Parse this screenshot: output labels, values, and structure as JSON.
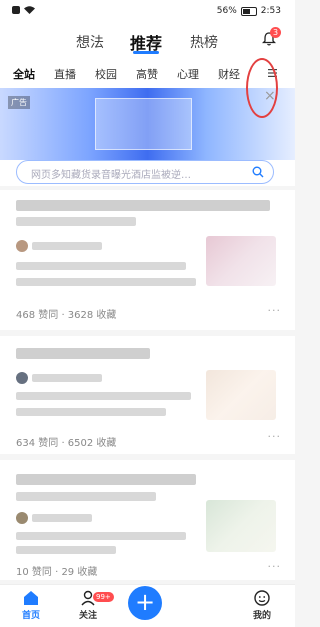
{
  "status_bar": {
    "battery": "56%",
    "battery_level": 0.56,
    "time": "2:53"
  },
  "top_tabs": [
    {
      "label": "想法"
    },
    {
      "label": "推荐"
    },
    {
      "label": "热榜"
    }
  ],
  "notifications": {
    "count": "3"
  },
  "categories": [
    "全站",
    "直播",
    "校园",
    "高赞",
    "心理",
    "财经"
  ],
  "banner": {
    "ad_label": "广告",
    "close_label": "×"
  },
  "search": {
    "placeholder": "网页多知藏货录音曝光酒店监被逆…"
  },
  "feed": [
    {
      "stats": "468 赞同 · 3628 收藏"
    },
    {
      "stats": "634 赞同 · 6502 收藏"
    },
    {
      "stats": "10 赞同 · 29 收藏"
    }
  ],
  "bottom_nav": [
    {
      "label": "首页"
    },
    {
      "label": "关注",
      "badge": "99+"
    },
    {
      "label": "我的"
    }
  ],
  "create_button": "+",
  "colors": {
    "accent": "#1f7cff",
    "badge": "#ff4d4f",
    "highlight": "#e34040"
  }
}
